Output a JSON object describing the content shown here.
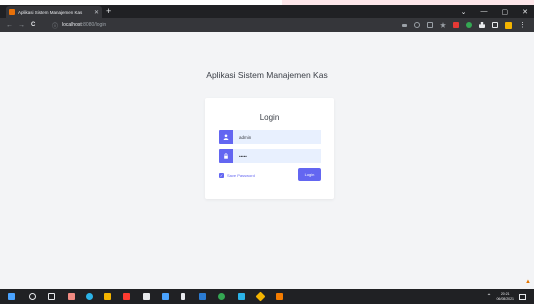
{
  "browser": {
    "tab_title": "Aplikasi Sistem Manajemen Kas",
    "tab_close": "✕",
    "new_tab": "+",
    "url_host": "localhost",
    "url_path": ":8080/login",
    "window_controls": [
      "⌄",
      "—",
      "▢",
      "✕"
    ],
    "nav": {
      "back": "←",
      "forward": "→",
      "reload": "C",
      "info": "ⓘ"
    }
  },
  "page": {
    "app_title": "Aplikasi Sistem Manajemen Kas",
    "login_title": "Login",
    "username_value": "admin",
    "password_value": "•••••",
    "remember_label": "Save Password",
    "login_button": "Login"
  },
  "taskbar": {
    "time": "20:21",
    "date": "06/08/2021"
  },
  "colors": {
    "accent": "#6366f1",
    "input_bg": "#e8f0fe",
    "page_bg": "#f3f4f6",
    "chrome_dark": "#202124"
  }
}
